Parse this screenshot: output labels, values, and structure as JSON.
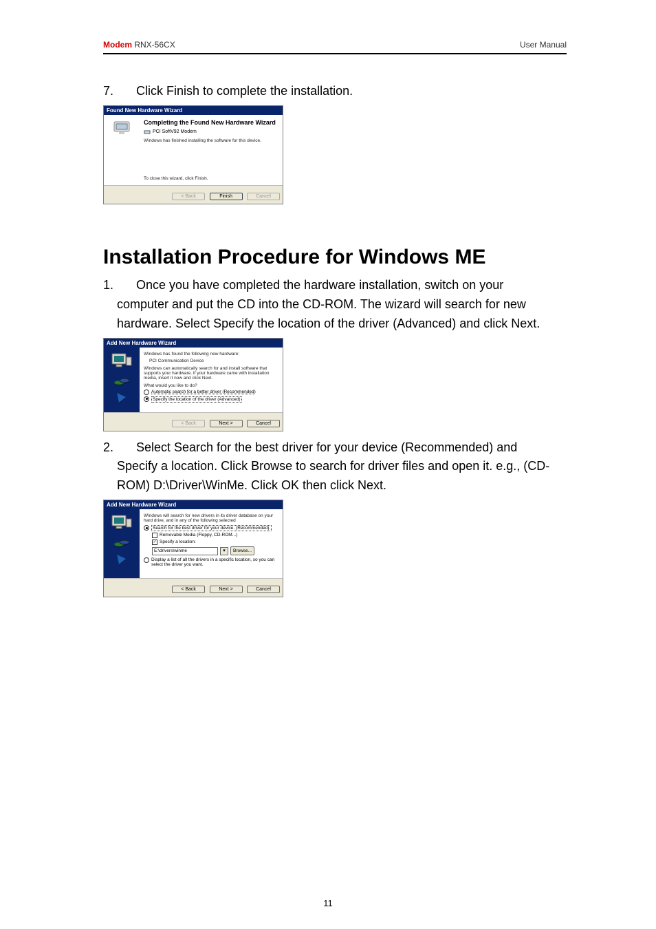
{
  "header": {
    "brand": "Modem",
    "model": "RNX-56CX",
    "right": "User  Manual"
  },
  "step7": {
    "num": "7.",
    "text": "Click Finish to complete the installation."
  },
  "wiz1": {
    "title": "Found New Hardware Wizard",
    "heading": "Completing the Found New Hardware Wizard",
    "device": "PCI SoftV92 Modem",
    "line1": "Windows has finished installing the software for this device.",
    "line2": "To close this wizard, click Finish.",
    "back": "< Back",
    "finish": "Finish",
    "cancel": "Cancel"
  },
  "heading": "Installation Procedure for Windows ME",
  "step1": {
    "num": "1.",
    "text": "Once you have completed the hardware installation, switch on your computer and put the CD into the CD-ROM. The wizard will search for new hardware. Select Specify the location of the driver (Advanced) and click Next."
  },
  "wiz2": {
    "title": "Add New Hardware Wizard",
    "found": "Windows has found the following new hardware:",
    "device": "PCI Communication Device",
    "para": "Windows can automatically search for and install software that supports your hardware. If your hardware came with installation media, insert it now and click Next.",
    "question": "What would you like to do?",
    "opt1": "Automatic search for a better driver (Recommended)",
    "opt2": "Specify the location of the driver (Advanced)",
    "back": "< Back",
    "next": "Next >",
    "cancel": "Cancel"
  },
  "step2": {
    "num": "2.",
    "text": "Select Search for the best driver for your device (Recommended) and Specify a location. Click Browse to search for driver files and open it. e.g., (CD-ROM) D:\\Driver\\WinMe. Click OK then click Next."
  },
  "wiz3": {
    "title": "Add New Hardware Wizard",
    "para": "Windows will search for new drivers in its driver database on your hard drive, and in any of the following selected",
    "opt1": "Search for the best driver for your device. (Recommended).",
    "chk1": "Removable Media (Floppy, CD-ROM...)",
    "chk2": "Specify a location:",
    "path": "E:\\drivers\\winme",
    "browse": "Browse...",
    "opt2": "Display a list of all the drivers in a specific location, so you can select the driver you want.",
    "back": "< Back",
    "next": "Next >",
    "cancel": "Cancel"
  },
  "pagenum": "11"
}
